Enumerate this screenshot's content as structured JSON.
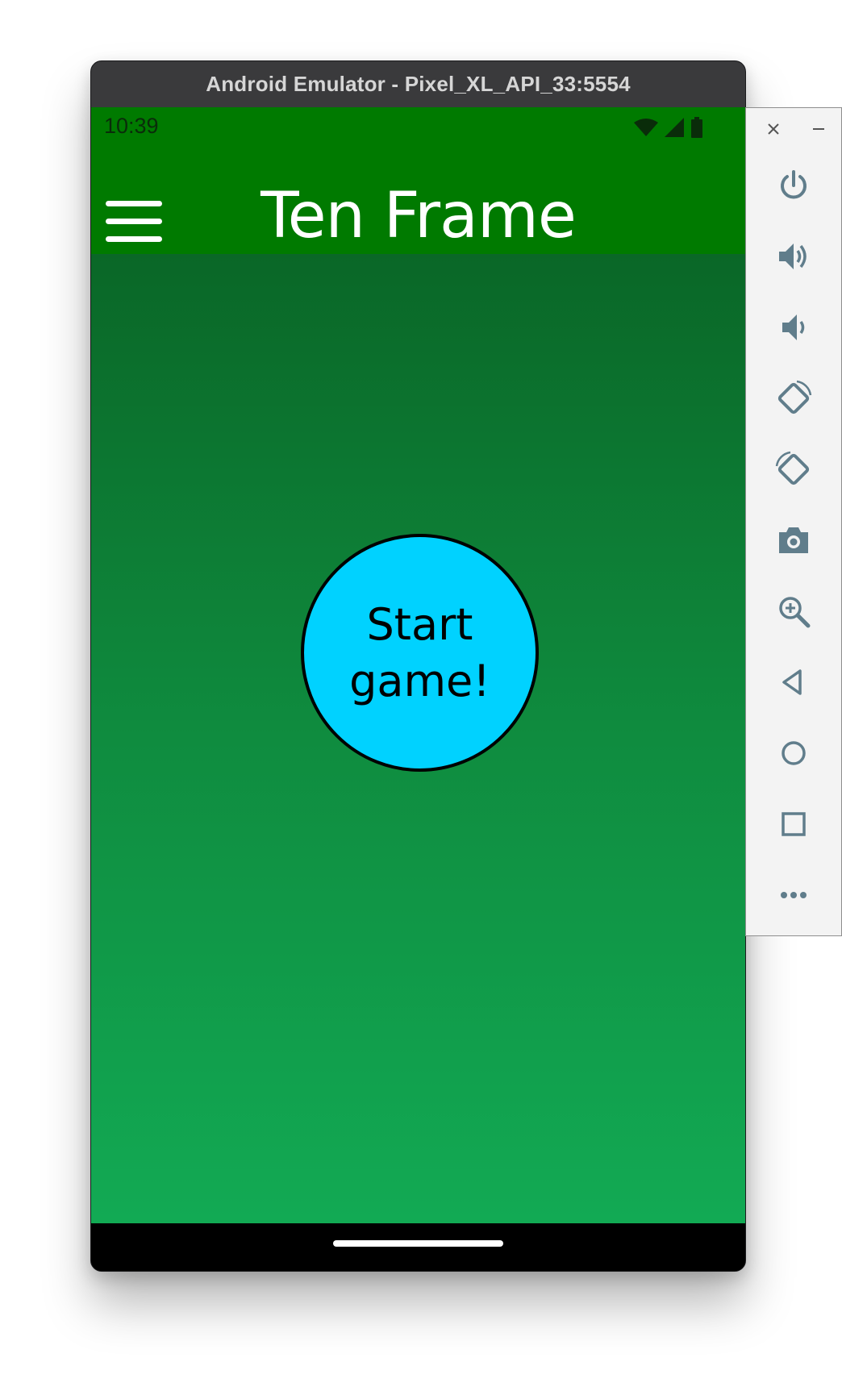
{
  "window": {
    "title": "Android Emulator - Pixel_XL_API_33:5554"
  },
  "status_bar": {
    "time": "10:39",
    "icons": [
      "wifi-icon",
      "cell-signal-icon",
      "battery-icon"
    ]
  },
  "app_bar": {
    "title": "Ten Frame",
    "menu_icon": "hamburger-menu-icon"
  },
  "main": {
    "start_button_label": "Start game!"
  },
  "side_panel": {
    "controls": [
      "close-icon",
      "minimize-icon",
      "power-icon",
      "volume-up-icon",
      "volume-down-icon",
      "rotate-left-icon",
      "rotate-right-icon",
      "camera-icon",
      "zoom-icon",
      "back-icon",
      "home-icon",
      "overview-icon",
      "more-icon"
    ]
  },
  "colors": {
    "app_bar": "#007a00",
    "gradient_top": "#0a6727",
    "gradient_bottom": "#12aa54",
    "start_button": "#00d2ff",
    "title_bar": "#3a3a3c",
    "panel_icon": "#607d8b"
  }
}
